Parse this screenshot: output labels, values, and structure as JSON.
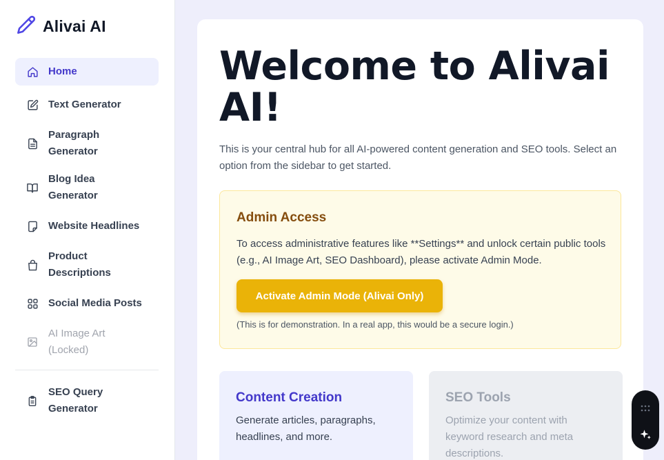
{
  "brand": {
    "name": "Alivai AI",
    "icon": "pencil-icon",
    "accent": "#4f46e5"
  },
  "sidebar": {
    "items": [
      {
        "label": "Home",
        "icon": "home-icon",
        "active": true
      },
      {
        "label": "Text Generator",
        "icon": "edit-icon"
      },
      {
        "label": "Paragraph Generator",
        "icon": "document-icon"
      },
      {
        "label": "Blog Idea Generator",
        "icon": "book-icon"
      },
      {
        "label": "Website Headlines",
        "icon": "note-icon"
      },
      {
        "label": "Product Descriptions",
        "icon": "shopping-bag-icon"
      },
      {
        "label": "Social Media Posts",
        "icon": "grid-icon"
      },
      {
        "label": "AI Image Art (Locked)",
        "icon": "image-icon",
        "locked": true
      },
      {
        "label": "SEO Query Generator",
        "icon": "clipboard-icon"
      }
    ]
  },
  "main": {
    "title": "Welcome to Alivai AI!",
    "intro": "This is your central hub for all AI-powered content generation and SEO tools. Select an option from the sidebar to get started.",
    "admin": {
      "title": "Admin Access",
      "description": "To access administrative features like **Settings** and unlock certain public tools (e.g., AI Image Art, SEO Dashboard), please activate Admin Mode.",
      "button_label": "Activate Admin Mode (Alivai Only)",
      "note": "(This is for demonstration. In a real app, this would be a secure login.)",
      "accent": "#eab308"
    },
    "cards": [
      {
        "title": "Content Creation",
        "description": "Generate articles, paragraphs, headlines, and more."
      },
      {
        "title": "SEO Tools",
        "description": "Optimize your content with keyword research and meta descriptions."
      }
    ]
  },
  "widget": {
    "icons": [
      "grip-icon",
      "sparkle-icon"
    ]
  }
}
